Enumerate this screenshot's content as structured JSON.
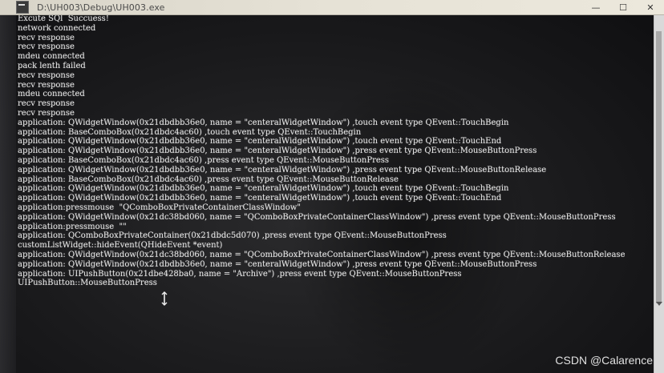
{
  "window": {
    "title": "D:\\UH003\\Debug\\UH003.exe",
    "controls": {
      "minimize": "—",
      "maximize": "☐",
      "close": "✕"
    }
  },
  "console": {
    "lines": [
      "Excute SQl  Succuess!",
      "network connected",
      "recv response",
      "recv response",
      "mdeu connected",
      "pack lenth failed",
      "recv response",
      "recv response",
      "mdeu connected",
      "recv response",
      "recv response",
      "application: QWidgetWindow(0x21dbdbb36e0, name = \"centeralWidgetWindow\") ,touch event type QEvent::TouchBegin",
      "application: BaseComboBox(0x21dbdc4ac60) ,touch event type QEvent::TouchBegin",
      "application: QWidgetWindow(0x21dbdbb36e0, name = \"centeralWidgetWindow\") ,touch event type QEvent::TouchEnd",
      "application: QWidgetWindow(0x21dbdbb36e0, name = \"centeralWidgetWindow\") ,press event type QEvent::MouseButtonPress",
      "application: BaseComboBox(0x21dbdc4ac60) ,press event type QEvent::MouseButtonPress",
      "application: QWidgetWindow(0x21dbdbb36e0, name = \"centeralWidgetWindow\") ,press event type QEvent::MouseButtonRelease",
      "application: BaseComboBox(0x21dbdc4ac60) ,press event type QEvent::MouseButtonRelease",
      "application: QWidgetWindow(0x21dbdbb36e0, name = \"centeralWidgetWindow\") ,touch event type QEvent::TouchBegin",
      "application: QWidgetWindow(0x21dbdbb36e0, name = \"centeralWidgetWindow\") ,touch event type QEvent::TouchEnd",
      "application:pressmouse  \"QComboBoxPrivateContainerClassWindow\"",
      "application: QWidgetWindow(0x21dc38bd060, name = \"QComboBoxPrivateContainerClassWindow\") ,press event type QEvent::MouseButtonPress",
      "application:pressmouse  \"\"",
      "application: QComboBoxPrivateContainer(0x21dbdc5d070) ,press event type QEvent::MouseButtonPress",
      "customListWidget::hideEvent(QHideEvent *event)",
      "application: QWidgetWindow(0x21dc38bd060, name = \"QComboBoxPrivateContainerClassWindow\") ,press event type QEvent::MouseButtonRelease",
      "application: QWidgetWindow(0x21dbdbb36e0, name = \"centeralWidgetWindow\") ,press event type QEvent::MouseButtonPress",
      "application: UIPushButton(0x21dbe428ba0, name = \"Archive\") ,press event type QEvent::MouseButtonPress",
      "UIPushButton::MouseButtonPress"
    ]
  },
  "watermark": "CSDN @Calarence",
  "colors": {
    "console_text": "#e6e6e6",
    "console_bg": "#1c1c1e",
    "titlebar_bg": "#e2ded2"
  },
  "icons": {
    "app": "console-app-icon",
    "cursor": "text-cursor-icon"
  }
}
